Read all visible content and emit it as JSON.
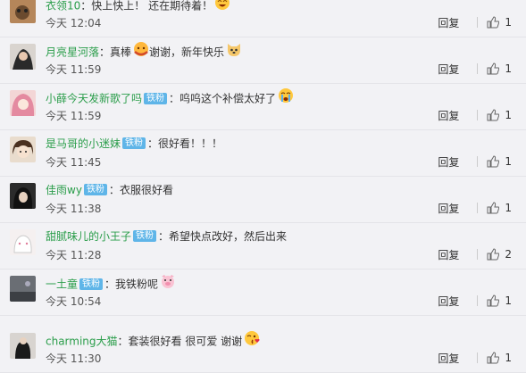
{
  "comments": [
    {
      "user": "衣领10",
      "badge": "",
      "text": "快上快上！  还在期待着！",
      "emoji": "laugh-face-icon",
      "time": "今天 12:04",
      "likes": "1"
    },
    {
      "user": "月亮星河落",
      "badge": "",
      "text": "真棒",
      "emoji2": "hug-face-icon",
      "text2": "谢谢，新年快乐",
      "emoji": "dog-face-icon",
      "time": "今天 11:59",
      "likes": "1"
    },
    {
      "user": "小薛今天发新歌了吗",
      "badge": "铁粉",
      "text": "呜呜这个补偿太好了",
      "emoji": "crying-face-icon",
      "time": "今天 11:59",
      "likes": "1"
    },
    {
      "user": "是马哥的小迷妹",
      "badge": "铁粉",
      "text": "很好看！！！",
      "emoji": "",
      "time": "今天 11:45",
      "likes": "1"
    },
    {
      "user": "佳雨wy",
      "badge": "铁粉",
      "text": "衣服很好看",
      "emoji": "",
      "time": "今天 11:38",
      "likes": "1"
    },
    {
      "user": "甜腻味儿的小王子",
      "badge": "铁粉",
      "text": "希望快点改好，然后出来",
      "emoji": "",
      "time": "今天 11:28",
      "likes": "2"
    },
    {
      "user": "一土童",
      "badge": "铁粉",
      "text": "我铁粉呢",
      "emoji": "pig-face-icon",
      "time": "今天 10:54",
      "likes": "1"
    },
    {
      "user": "charming大猫",
      "badge": "",
      "text": "套装很好看 很可爱 谢谢",
      "emoji": "kiss-face-icon",
      "time": "今天 11:30",
      "likes": "1"
    }
  ],
  "labels": {
    "reply": "回复",
    "colon": "："
  },
  "colors": {
    "username": "#2a9d4a",
    "badge": "#5fb5e8",
    "background": "#f2f2f5"
  }
}
